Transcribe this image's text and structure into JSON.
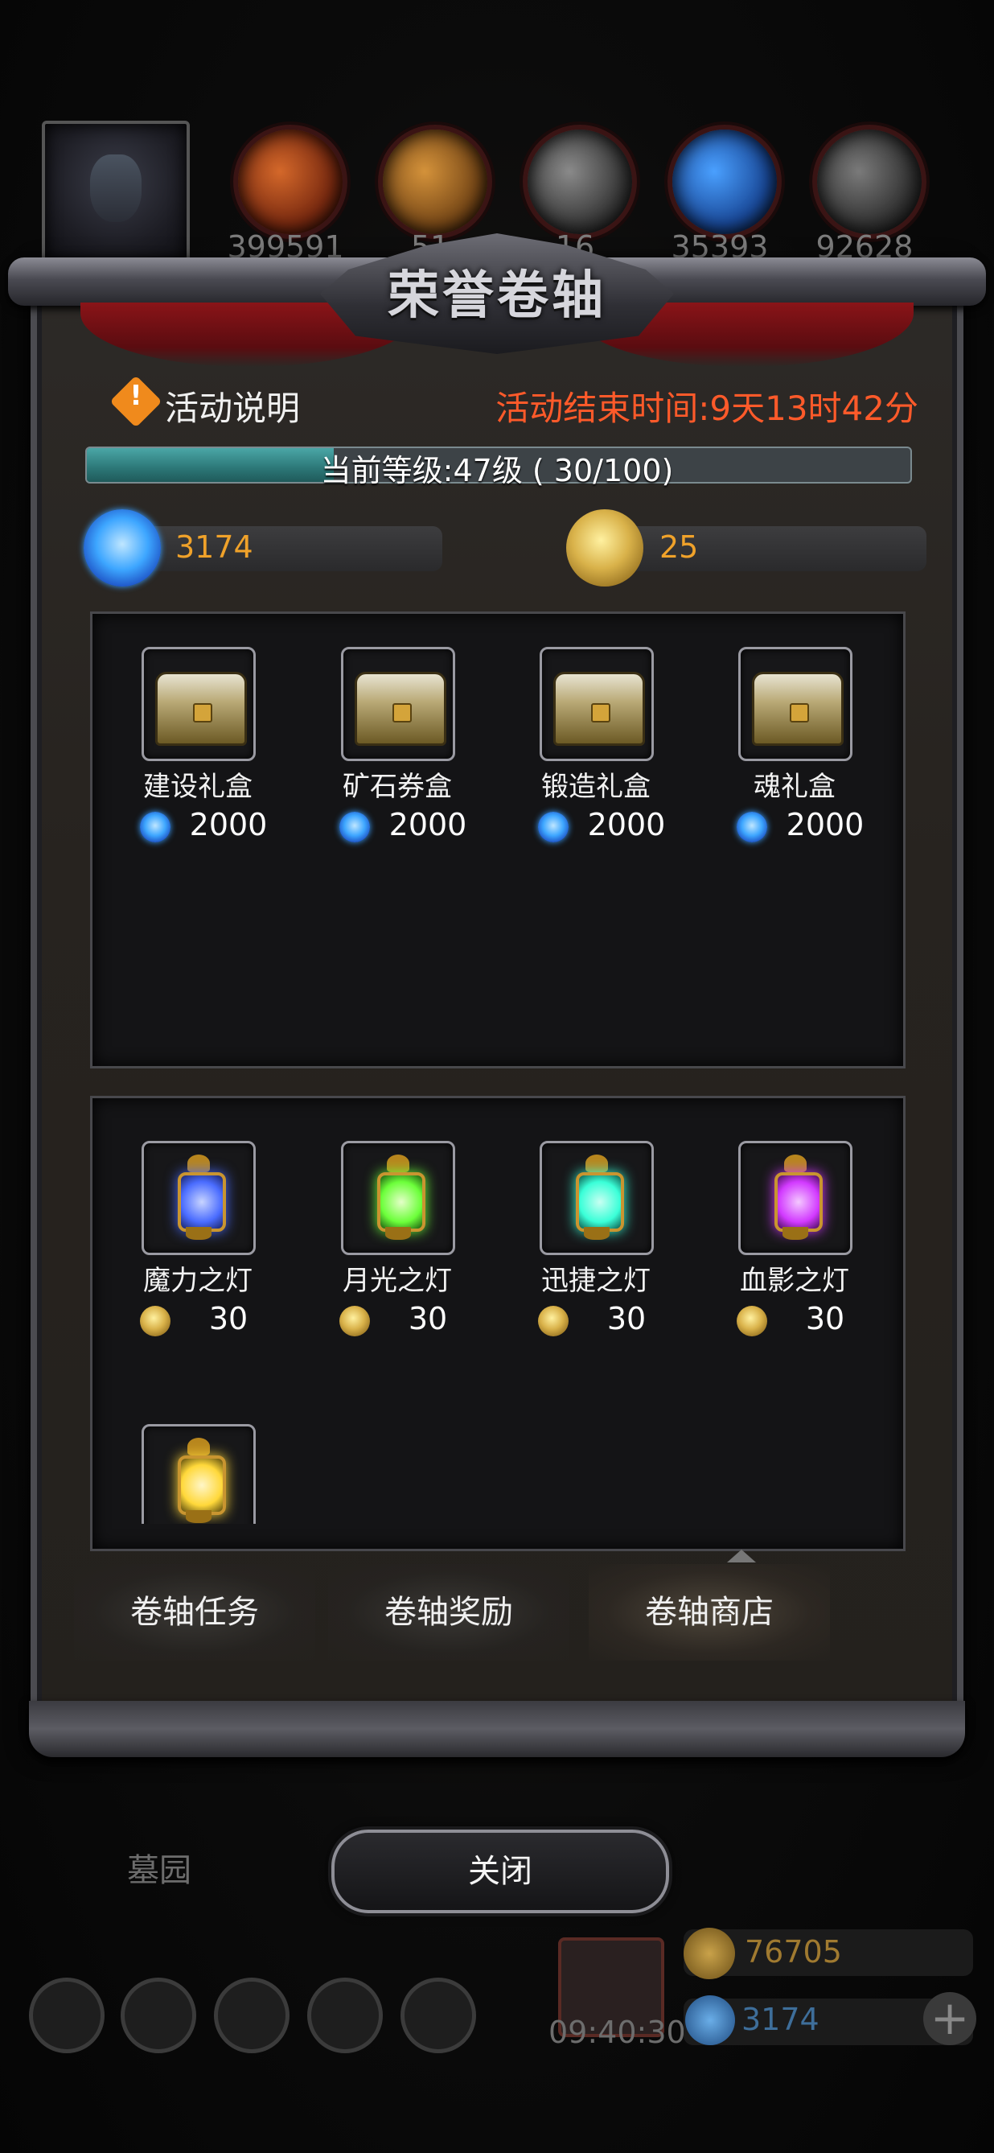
{
  "top_bar": {
    "resources": [
      {
        "value": "399591",
        "icon": "ore-orange-icon",
        "color": "#d4682a"
      },
      {
        "value": "51",
        "icon": "wood-plank-icon",
        "color": "#c4803a"
      },
      {
        "value": "16",
        "icon": "iron-ingot-icon",
        "color": "#6a6a6a"
      },
      {
        "value": "35393",
        "icon": "blue-crystal-icon",
        "color": "#2e7fd8"
      },
      {
        "value": "92628",
        "icon": "stone-block-icon",
        "color": "#5a5a5a"
      }
    ]
  },
  "panel": {
    "title": "荣誉卷轴",
    "info_label": "活动说明",
    "info_icon_mark": "!",
    "end_time": "活动结束时间:9天13时42分",
    "level_text": "当前等级:47级 ( 30/100)",
    "level_progress": 0.3,
    "gem_balance": "3174",
    "coin_balance": "25"
  },
  "shop_gem": [
    {
      "name": "建设礼盒",
      "price": "2000"
    },
    {
      "name": "矿石券盒",
      "price": "2000"
    },
    {
      "name": "锻造礼盒",
      "price": "2000"
    },
    {
      "name": "魂礼盒",
      "price": "2000"
    }
  ],
  "shop_coin": [
    {
      "name": "魔力之灯",
      "price": "30",
      "glow": "#4a6cff"
    },
    {
      "name": "月光之灯",
      "price": "30",
      "glow": "#6cff3a"
    },
    {
      "name": "迅捷之灯",
      "price": "30",
      "glow": "#3affd8"
    },
    {
      "name": "血影之灯",
      "price": "30",
      "glow": "#d23aff"
    }
  ],
  "tabs": [
    "卷轴任务",
    "卷轴奖励",
    "卷轴商店"
  ],
  "active_tab": 2,
  "close_label": "关闭",
  "background": {
    "location_label": "墓园",
    "timer": "09:40:30",
    "gold_amount": "76705",
    "gem_amount": "3174",
    "plus_label": "+"
  },
  "colors": {
    "accent_orange": "#f0a22a",
    "end_time_red": "#ff5a2a",
    "level_bar": "#2c7777"
  }
}
